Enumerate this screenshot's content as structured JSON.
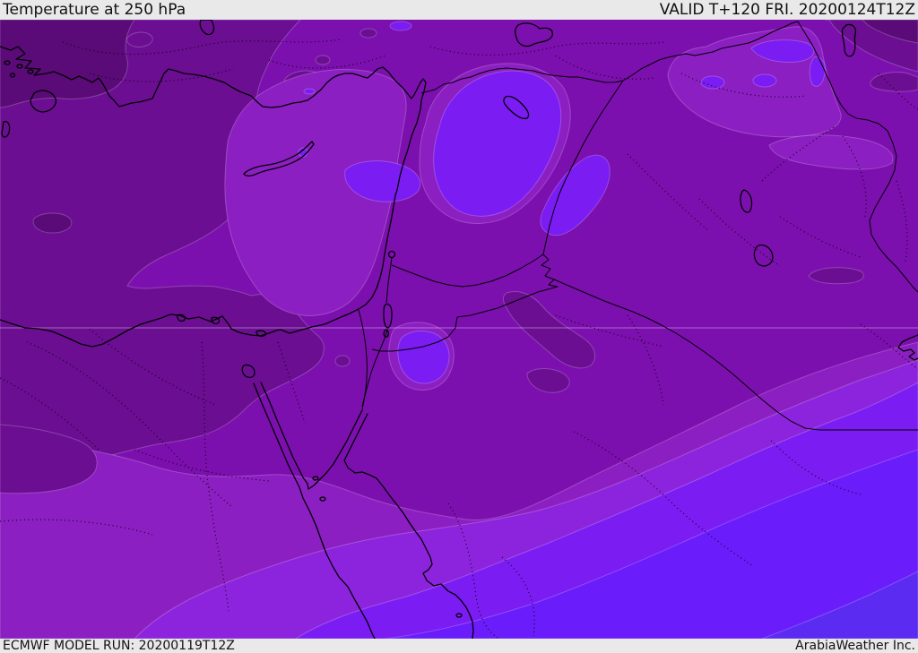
{
  "header": {
    "title": "Temperature at 250 hPa",
    "valid": "VALID T+120 FRI. 20200124T12Z"
  },
  "footer": {
    "model_run": "ECMWF MODEL RUN: 20200119T12Z",
    "brand": "ArabiaWeather Inc."
  },
  "map": {
    "parameter": "Temperature",
    "level": "250 hPa",
    "model": "ECMWF",
    "region": "Middle East / Eastern Mediterranean",
    "palette": {
      "warmest": "#5a0b78",
      "dark": "#6b0e92",
      "base": "#7c10ae",
      "light": "#8c1fc2",
      "lighter": "#8d24dd",
      "cold": "#7b1cf3",
      "colder": "#6a1dfa",
      "coldest": "#5b2bf1",
      "coast": "#000000",
      "chrome": "#e9e9e9",
      "latline": "rgba(255,255,255,0.38)"
    }
  }
}
